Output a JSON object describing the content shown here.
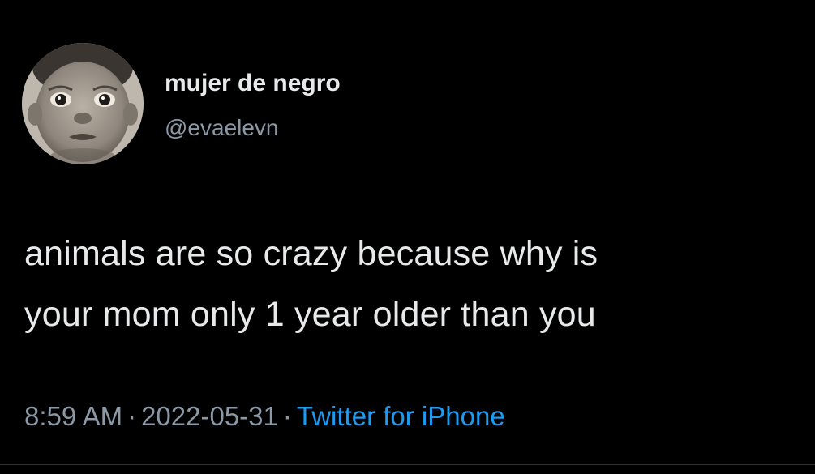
{
  "tweet": {
    "author": {
      "display_name": "mujer de negro",
      "handle": "@evaelevn"
    },
    "text_line1": "animals are so crazy because why is",
    "text_line2": "your mom only 1 year older than you",
    "time": "8:59 AM",
    "separator": "·",
    "date": "2022-05-31",
    "source": "Twitter for iPhone"
  },
  "colors": {
    "background": "#000000",
    "primary_text": "#e7e9ea",
    "secondary_text": "#8b98a5",
    "link": "#1d9bf0"
  },
  "icons": {
    "avatar": "baby-face-photo"
  }
}
